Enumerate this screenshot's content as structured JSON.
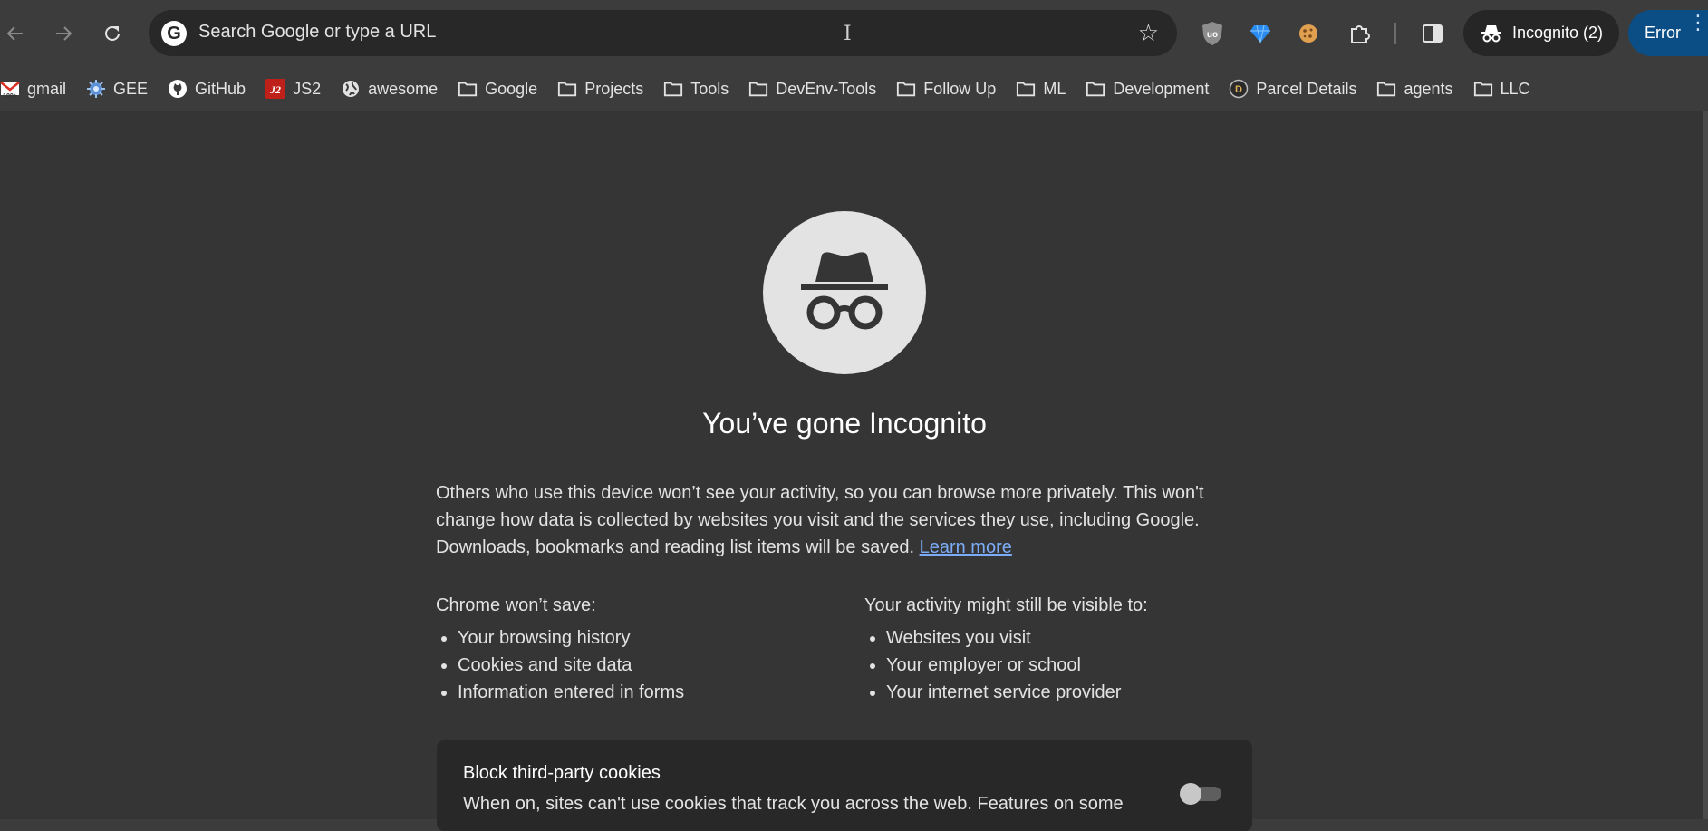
{
  "toolbar": {
    "omnibox_placeholder": "Search Google or type a URL",
    "omnibox_logo": "G",
    "text_cursor_glyph": "I",
    "star_glyph": "☆",
    "incognito_label": "Incognito (2)",
    "error_label": "Error",
    "error_menu_glyph": "⋮",
    "extensions": [
      "ublock-origin-icon",
      "gem-extension-icon",
      "cookie-extension-icon",
      "puzzle-extensions-icon"
    ]
  },
  "bookmarks": [
    {
      "label": "gmail",
      "icon": "gmail-icon"
    },
    {
      "label": "GEE",
      "icon": "gee-icon"
    },
    {
      "label": "GitHub",
      "icon": "github-icon"
    },
    {
      "label": "JS2",
      "icon": "js2-icon"
    },
    {
      "label": "awesome",
      "icon": "globe-icon"
    },
    {
      "label": "Google",
      "icon": "folder-icon"
    },
    {
      "label": "Projects",
      "icon": "folder-icon"
    },
    {
      "label": "Tools",
      "icon": "folder-icon"
    },
    {
      "label": "DevEnv-Tools",
      "icon": "folder-icon"
    },
    {
      "label": "Follow Up",
      "icon": "folder-icon"
    },
    {
      "label": "ML",
      "icon": "folder-icon"
    },
    {
      "label": "Development",
      "icon": "folder-icon"
    },
    {
      "label": "Parcel Details",
      "icon": "parcel-icon"
    },
    {
      "label": "agents",
      "icon": "folder-icon"
    },
    {
      "label": "LLC",
      "icon": "folder-icon"
    }
  ],
  "page": {
    "headline": "You’ve gone Incognito",
    "lead_text": "Others who use this device won’t see your activity, so you can browse more privately. This won't change how data is collected by websites you visit and the services they use, including Google. Downloads, bookmarks and reading list items will be saved.",
    "learn_more": "Learn more",
    "wont_save": {
      "title": "Chrome won’t save:",
      "items": [
        "Your browsing history",
        "Cookies and site data",
        "Information entered in forms"
      ]
    },
    "might_be_visible": {
      "title": "Your activity might still be visible to:",
      "items": [
        "Websites you visit",
        "Your employer or school",
        "Your internet service provider"
      ]
    },
    "cookie_card": {
      "title": "Block third-party cookies",
      "description": "When on, sites can't use cookies that track you across the web. Features on some",
      "toggle_on": false
    }
  },
  "colors": {
    "background": "#353535",
    "toolbar": "#3c3c3c",
    "omnibox": "#282828",
    "link": "#7cacf8",
    "error_pill": "#0b4e86"
  }
}
